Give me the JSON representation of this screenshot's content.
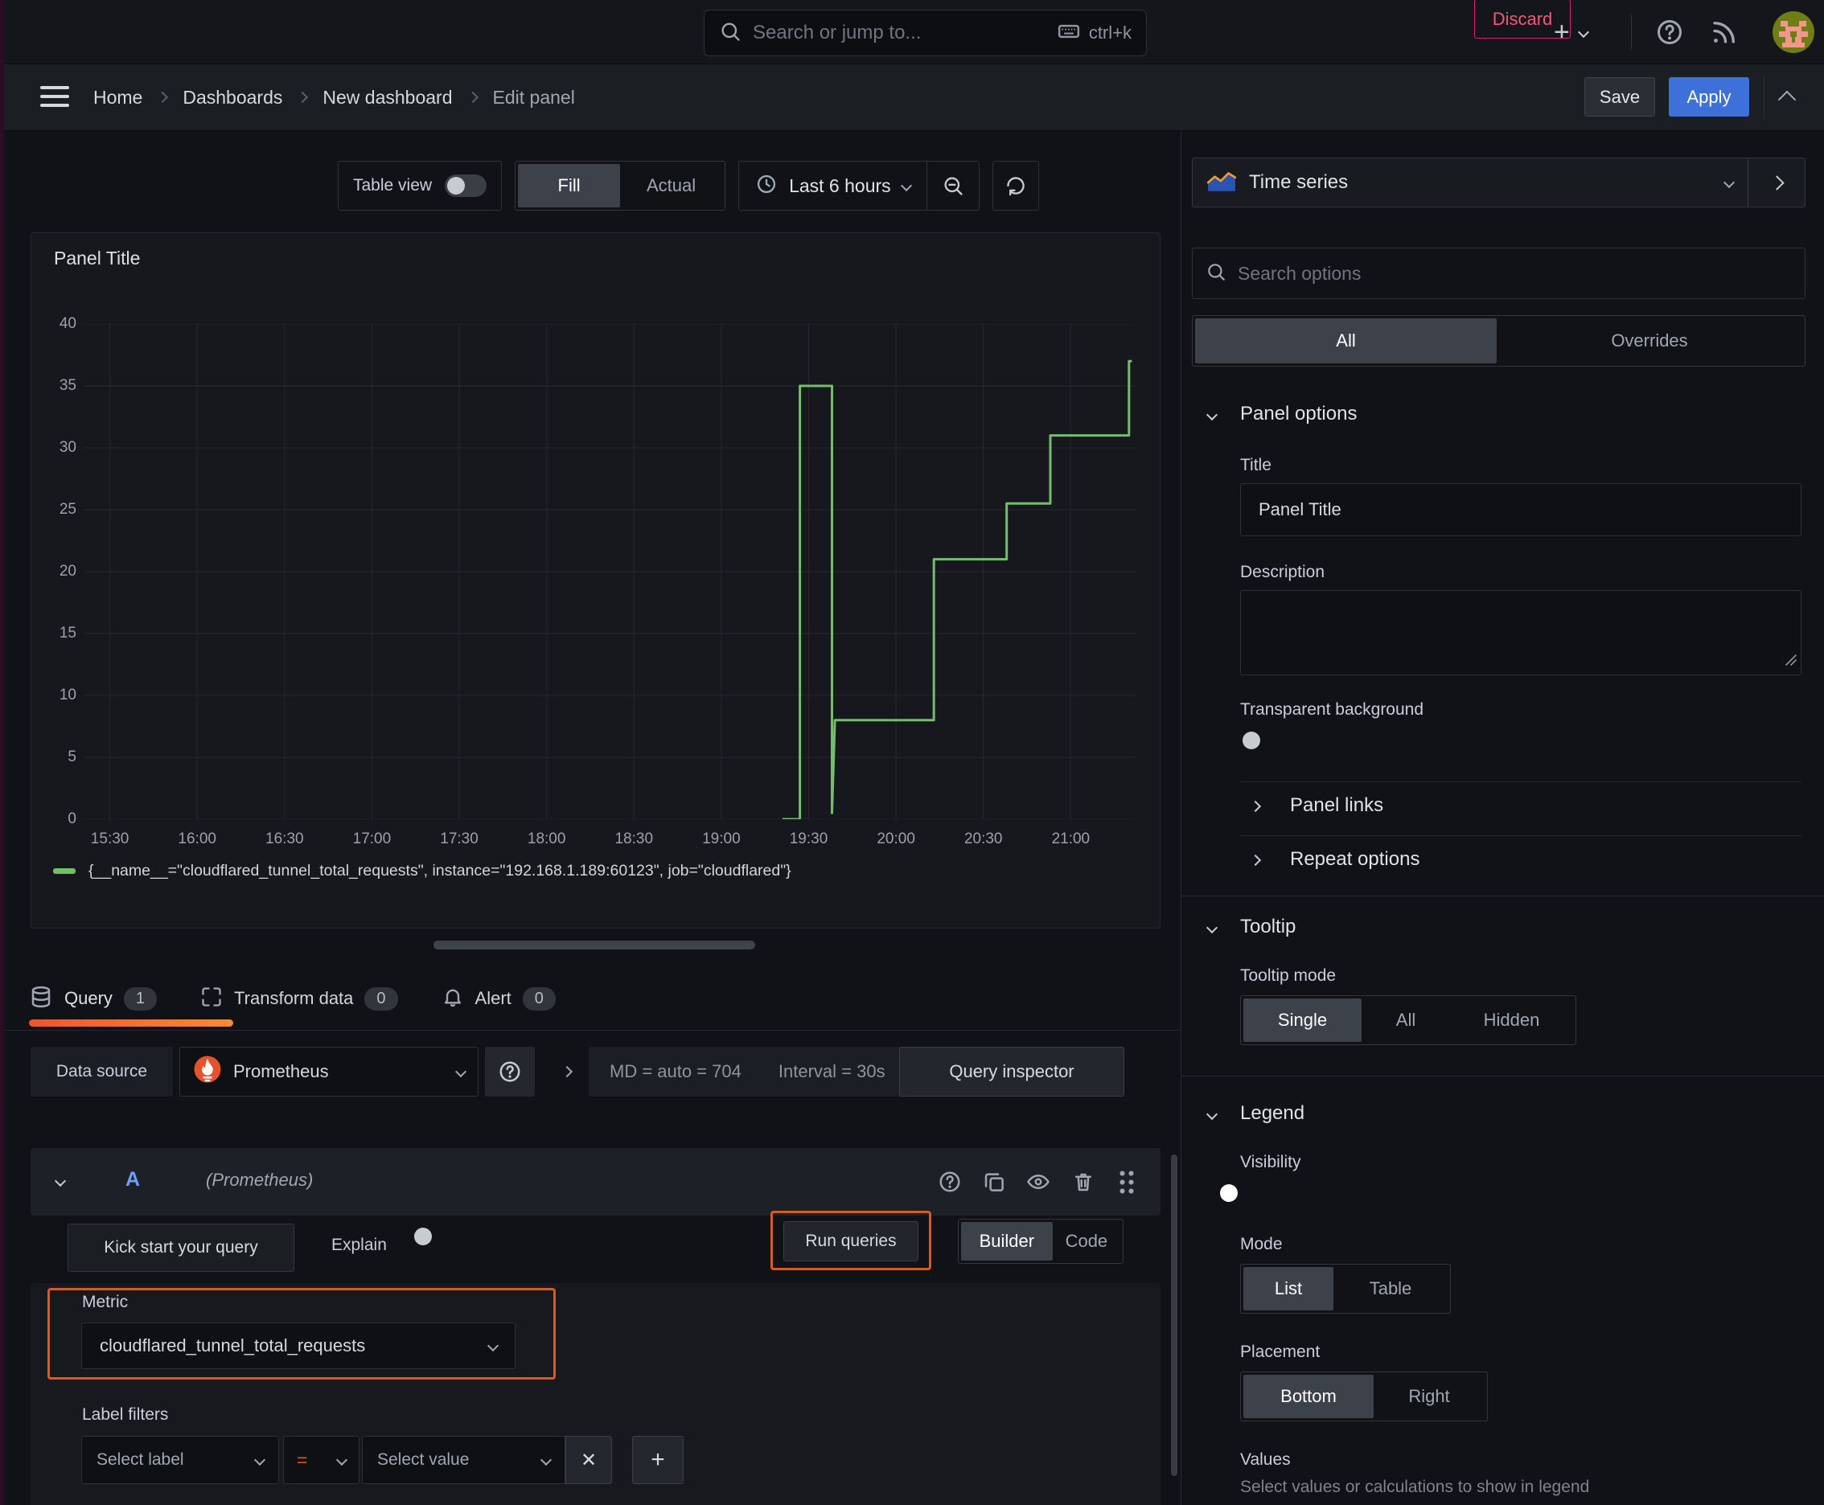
{
  "topbar": {
    "search_placeholder": "Search or jump to...",
    "shortcut": "ctrl+k",
    "new_glyph": "+"
  },
  "breadcrumb": {
    "home": "Home",
    "dashboards": "Dashboards",
    "new_dashboard": "New dashboard",
    "edit_panel": "Edit panel"
  },
  "actions": {
    "discard": "Discard",
    "save": "Save",
    "apply": "Apply"
  },
  "toolbar": {
    "table_view": "Table view",
    "fill": "Fill",
    "actual": "Actual",
    "time_range": "Last 6 hours"
  },
  "chart_data": {
    "type": "line",
    "style": "step",
    "title": "Panel Title",
    "x_start": "15:21",
    "x_end": "21:22",
    "ylim": [
      0,
      40
    ],
    "yticks": [
      0,
      5,
      10,
      15,
      20,
      25,
      30,
      35,
      40
    ],
    "xticks": [
      "15:30",
      "16:00",
      "16:30",
      "17:00",
      "17:30",
      "18:00",
      "18:30",
      "19:00",
      "19:30",
      "20:00",
      "20:30",
      "21:00"
    ],
    "grid": true,
    "legend_position": "bottom",
    "series": [
      {
        "name": "{__name__=\"cloudflared_tunnel_total_requests\", instance=\"192.168.1.189:60123\", job=\"cloudflared\"}",
        "color": "#73bf69",
        "points": [
          [
            "19:21",
            0
          ],
          [
            "19:27",
            0
          ],
          [
            "19:27",
            35
          ],
          [
            "19:38",
            35
          ],
          [
            "19:38",
            0.5
          ],
          [
            "19:39",
            8
          ],
          [
            "20:13",
            8
          ],
          [
            "20:13",
            21
          ],
          [
            "20:38",
            21
          ],
          [
            "20:38",
            25.5
          ],
          [
            "20:53",
            25.5
          ],
          [
            "20:53",
            31
          ],
          [
            "21:20",
            31
          ],
          [
            "21:20",
            37
          ],
          [
            "21:21",
            37
          ]
        ]
      }
    ]
  },
  "tabs": {
    "query": "Query",
    "query_badge": 1,
    "transform": "Transform data",
    "transform_badge": 0,
    "alert": "Alert",
    "alert_badge": 0
  },
  "query": {
    "datasource_label": "Data source",
    "datasource_name": "Prometheus",
    "stats_left": "MD = auto = 704",
    "stats_right": "Interval = 30s",
    "inspector": "Query inspector",
    "ref_id": "A",
    "ref_ds": "(Prometheus)",
    "kickstart": "Kick start your query",
    "explain": "Explain",
    "run_queries": "Run queries",
    "builder": "Builder",
    "code": "Code",
    "metric_label": "Metric",
    "metric_value": "cloudflared_tunnel_total_requests",
    "label_filters": "Label filters",
    "select_label": "Select label",
    "operator": "=",
    "select_value": "Select value",
    "remove_glyph": "✕",
    "add_glyph": "+"
  },
  "options": {
    "viz_name": "Time series",
    "search_placeholder": "Search options",
    "tab_all": "All",
    "tab_overrides": "Overrides",
    "panel_options": "Panel options",
    "title_label": "Title",
    "title_value": "Panel Title",
    "description_label": "Description",
    "transparent_bg": "Transparent background",
    "panel_links": "Panel links",
    "repeat_options": "Repeat options",
    "tooltip": "Tooltip",
    "tooltip_mode": "Tooltip mode",
    "tooltip_single": "Single",
    "tooltip_all": "All",
    "tooltip_hidden": "Hidden",
    "legend": "Legend",
    "visibility": "Visibility",
    "mode": "Mode",
    "mode_list": "List",
    "mode_table": "Table",
    "placement": "Placement",
    "placement_bottom": "Bottom",
    "placement_right": "Right",
    "values_label": "Values",
    "values_help": "Select values or calculations to show in legend"
  },
  "colors": {
    "accent_blue": "#3d71d9",
    "highlight_orange": "#e0591c",
    "series_green": "#73bf69",
    "discard_pink": "#e0226c",
    "tab_indicator": "#f0552b"
  }
}
